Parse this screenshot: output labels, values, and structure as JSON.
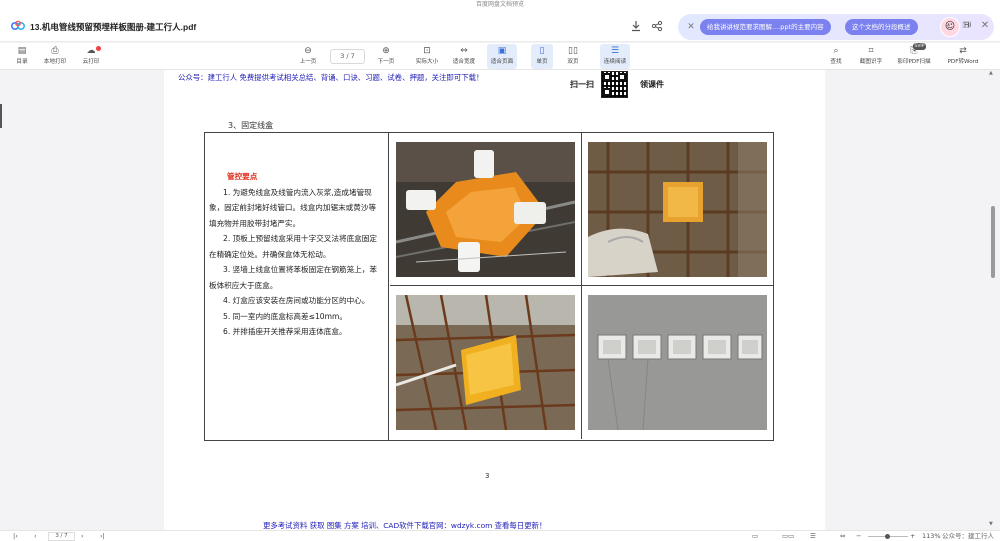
{
  "window_title": "百度网盘文档预览",
  "document": {
    "title": "13.机电管线预留预埋样板图册-建工行人.pdf"
  },
  "ai_assistant": {
    "suggestion_1": "给我讲讲规范要求图解....ppt的主要内容",
    "suggestion_2": "这个文档的分段概述",
    "greeting": "Hi"
  },
  "toolbar": {
    "left": [
      {
        "icon": "catalog-icon",
        "label": "目录"
      },
      {
        "icon": "printer-icon",
        "label": "本地打印"
      },
      {
        "icon": "cloud-print-icon",
        "label": "云打印"
      }
    ],
    "prev_label": "上一页",
    "page_indicator": "3 / 7",
    "next_label": "下一页",
    "actual_size_label": "实际大小",
    "fit_width_label": "适合宽度",
    "fit_page_label": "适合页面",
    "single_page_label": "单页",
    "double_page_label": "双页",
    "continuous_label": "连续阅读",
    "search_label": "查找",
    "ocr_label": "截图识字",
    "pdf_print_label": "影印PDF扫描",
    "pdf_badge": "SVIP",
    "pdf_word_label": "PDF转Word"
  },
  "page": {
    "header_notice": "公众号：建工行人 免费提供考试相关总结、背诵、口诀、习题、试卷、押题，关注即可下载！",
    "qr_left_text": "扫一扫",
    "qr_right_text": "领课件",
    "section_title": "3、固定线盒",
    "key_points_title": "管控要点",
    "points": [
      "1. 为避免线盒及线管内流入灰浆,造成堵管现象，固定前封堵好线管口。线盒内加锯末或黄沙等填充物并用胶带封堵严实。",
      "2. 顶板上预留线盒采用十字交叉法将底盒固定在精确定位处。并确保盒体无松动。",
      "3. 竖墙上线盒位置将苯板固定在钢筋笼上，苯板体积应大于底盒。",
      "4. 灯盒应该安装在房间或功能分区的中心。",
      "5. 同一室内的底盒标高差≤10mm。",
      "6. 并排插座开关推荐采用连体底盒。"
    ],
    "page_number": "3",
    "footer_notice": "更多考试资料 获取 图集 方案 培训、CAD软件下载官网：wdzyk.com 查看每日更新！"
  },
  "statusbar": {
    "page_indicator": "3 / 7",
    "zoom": "113%",
    "watermark": "公众号：建工行人"
  },
  "colors": {
    "accent": "#3d6fd8",
    "notice_blue": "#2320b8",
    "key_red": "#e0301e",
    "ai_pill": "#7b81ee"
  }
}
